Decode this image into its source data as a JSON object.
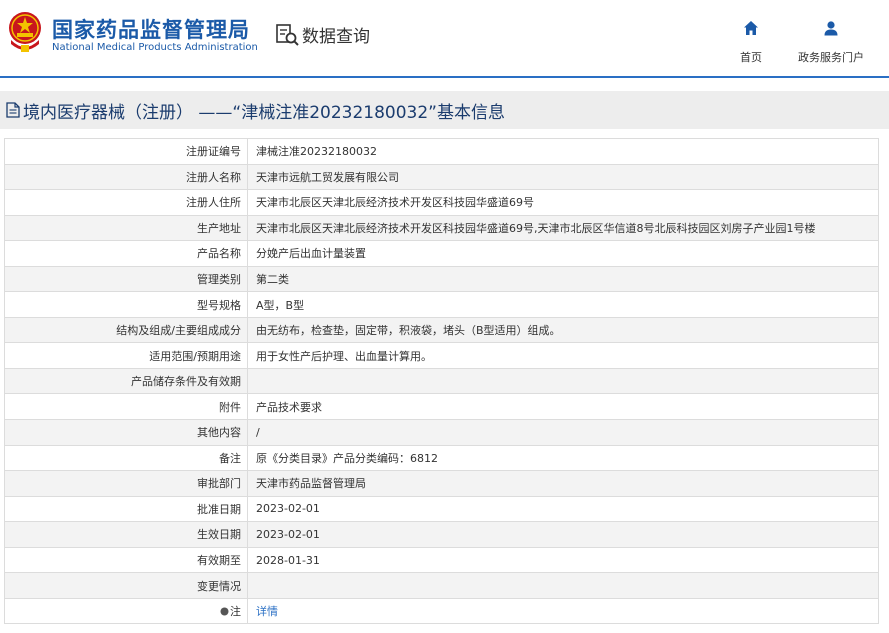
{
  "header": {
    "brand_cn": "国家药品监督管理局",
    "brand_en": "National Medical Products Administration",
    "query_label": "数据查询",
    "nav": [
      {
        "label": "首页",
        "icon": "home-icon"
      },
      {
        "label": "政务服务门户",
        "icon": "user-icon"
      }
    ]
  },
  "title": "境内医疗器械（注册） ——“津械注准20232180032”基本信息",
  "rows": [
    {
      "label": "注册证编号",
      "value": "津械注准20232180032"
    },
    {
      "label": "注册人名称",
      "value": "天津市远航工贸发展有限公司"
    },
    {
      "label": "注册人住所",
      "value": "天津市北辰区天津北辰经济技术开发区科技园华盛道69号"
    },
    {
      "label": "生产地址",
      "value": "天津市北辰区天津北辰经济技术开发区科技园华盛道69号,天津市北辰区华信道8号北辰科技园区刘房子产业园1号楼"
    },
    {
      "label": "产品名称",
      "value": "分娩产后出血计量装置"
    },
    {
      "label": "管理类别",
      "value": "第二类"
    },
    {
      "label": "型号规格",
      "value": "A型，B型"
    },
    {
      "label": "结构及组成/主要组成成分",
      "value": "由无纺布，检查垫，固定带，积液袋，堵头（B型适用）组成。"
    },
    {
      "label": "适用范围/预期用途",
      "value": "用于女性产后护理、出血量计算用。"
    },
    {
      "label": "产品储存条件及有效期",
      "value": ""
    },
    {
      "label": "附件",
      "value": "产品技术要求"
    },
    {
      "label": "其他内容",
      "value": "/"
    },
    {
      "label": "备注",
      "value": "原《分类目录》产品分类编码：6812"
    },
    {
      "label": "审批部门",
      "value": "天津市药品监督管理局"
    },
    {
      "label": "批准日期",
      "value": "2023-02-01"
    },
    {
      "label": "生效日期",
      "value": "2023-02-01"
    },
    {
      "label": "有效期至",
      "value": "2028-01-31"
    },
    {
      "label": "变更情况",
      "value": ""
    }
  ],
  "remark": {
    "label": "注",
    "link_text": "详情"
  },
  "colors": {
    "brand": "#1b5aa8",
    "header_line": "#2a6fc4",
    "link": "#2a6fc4",
    "title_bg": "#ededed"
  }
}
